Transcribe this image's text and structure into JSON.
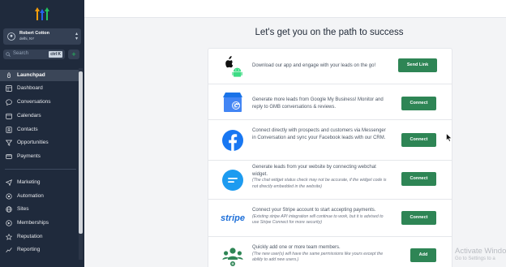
{
  "sidebar": {
    "account": {
      "name": "Robert Cotton",
      "location": "delhi, NY"
    },
    "search": {
      "placeholder": "Search",
      "shortcut": "ctrl K"
    },
    "plus": "+",
    "items": [
      {
        "label": "Launchpad",
        "icon": "rocket-icon",
        "active": true
      },
      {
        "label": "Dashboard",
        "icon": "dashboard-icon"
      },
      {
        "label": "Conversations",
        "icon": "chat-icon"
      },
      {
        "label": "Calendars",
        "icon": "calendar-icon"
      },
      {
        "label": "Contacts",
        "icon": "contacts-icon"
      },
      {
        "label": "Opportunities",
        "icon": "funnel-icon"
      },
      {
        "label": "Payments",
        "icon": "payments-icon"
      },
      {
        "label": "Marketing",
        "icon": "send-icon"
      },
      {
        "label": "Automation",
        "icon": "automation-icon"
      },
      {
        "label": "Sites",
        "icon": "globe-icon"
      },
      {
        "label": "Memberships",
        "icon": "membership-icon"
      },
      {
        "label": "Reputation",
        "icon": "star-icon"
      },
      {
        "label": "Reporting",
        "icon": "chart-icon"
      }
    ]
  },
  "main": {
    "title": "Let's get you on the path to success",
    "rows": [
      {
        "text": "Download our app and engage with your leads on the go!",
        "button": "Send Link",
        "icon": "apple-android-icon"
      },
      {
        "text": "Generate more leads from Google My Business! Monitor and reply to GMB conversations & reviews.",
        "button": "Connect",
        "icon": "google-my-business-icon"
      },
      {
        "text": "Connect directly with prospects and customers via Messenger in Conversation and sync your Facebook leads with our CRM.",
        "button": "Connect",
        "icon": "facebook-icon"
      },
      {
        "text": "Generate leads from your website by connecting webchat widget.",
        "subtext": "(The chat widget status check may not be accurate, if the widget code is not directly embedded in the website)",
        "button": "Connect",
        "icon": "webchat-icon"
      },
      {
        "text": "Connect your Stripe account to start accepting payments.",
        "subtext": "(Existing stripe API integration will continue to work, but it is advised to use Stripe Connect for more security)",
        "button": "Connect",
        "icon": "stripe-icon",
        "icon_text": "stripe"
      },
      {
        "text": "Quickly add one or more team members.",
        "subtext": "(The new user(s) will have the same permissions like yours except the ability to add new users.)",
        "button": "Add",
        "icon": "team-icon"
      }
    ]
  },
  "watermark": {
    "line1": "Activate Windo",
    "line2": "Go to Settings to a"
  },
  "colors": {
    "sidebar": "#1f2a3c",
    "button": "#2e8555",
    "accent": "#1d9bf0"
  }
}
